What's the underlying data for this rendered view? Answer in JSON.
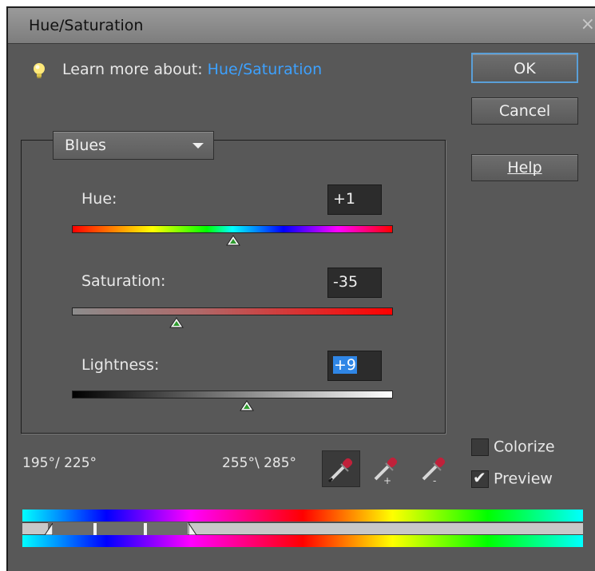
{
  "dialog": {
    "title": "Hue/Saturation",
    "close_glyph": "×"
  },
  "learn": {
    "prefix": "Learn more about: ",
    "link": "Hue/Saturation"
  },
  "buttons": {
    "ok": "OK",
    "cancel": "Cancel",
    "help": "Help"
  },
  "channel": {
    "selected": "Blues"
  },
  "sliders": {
    "hue": {
      "label": "Hue:",
      "value": "+1",
      "min": -180,
      "max": 180,
      "position": 1
    },
    "saturation": {
      "label": "Saturation:",
      "value": "-35",
      "min": -100,
      "max": 100,
      "position": -35
    },
    "lightness": {
      "label": "Lightness:",
      "value": "+9",
      "min": -100,
      "max": 100,
      "position": 9
    }
  },
  "ranges": {
    "left": "195°/ 225°",
    "right": "255°\\ 285°"
  },
  "options": {
    "colorize": {
      "label": "Colorize",
      "checked": false
    },
    "preview": {
      "label": "Preview",
      "checked": true
    }
  },
  "colors": {
    "link": "#3da1ff",
    "ok_border": "#5a9fd8",
    "selection": "#2f86e6"
  },
  "icons": [
    "bulb-icon",
    "close-icon",
    "chevron-down-icon",
    "eyedropper-icon",
    "eyedropper-add-icon",
    "eyedropper-subtract-icon",
    "check-icon",
    "slider-thumb-icon"
  ]
}
